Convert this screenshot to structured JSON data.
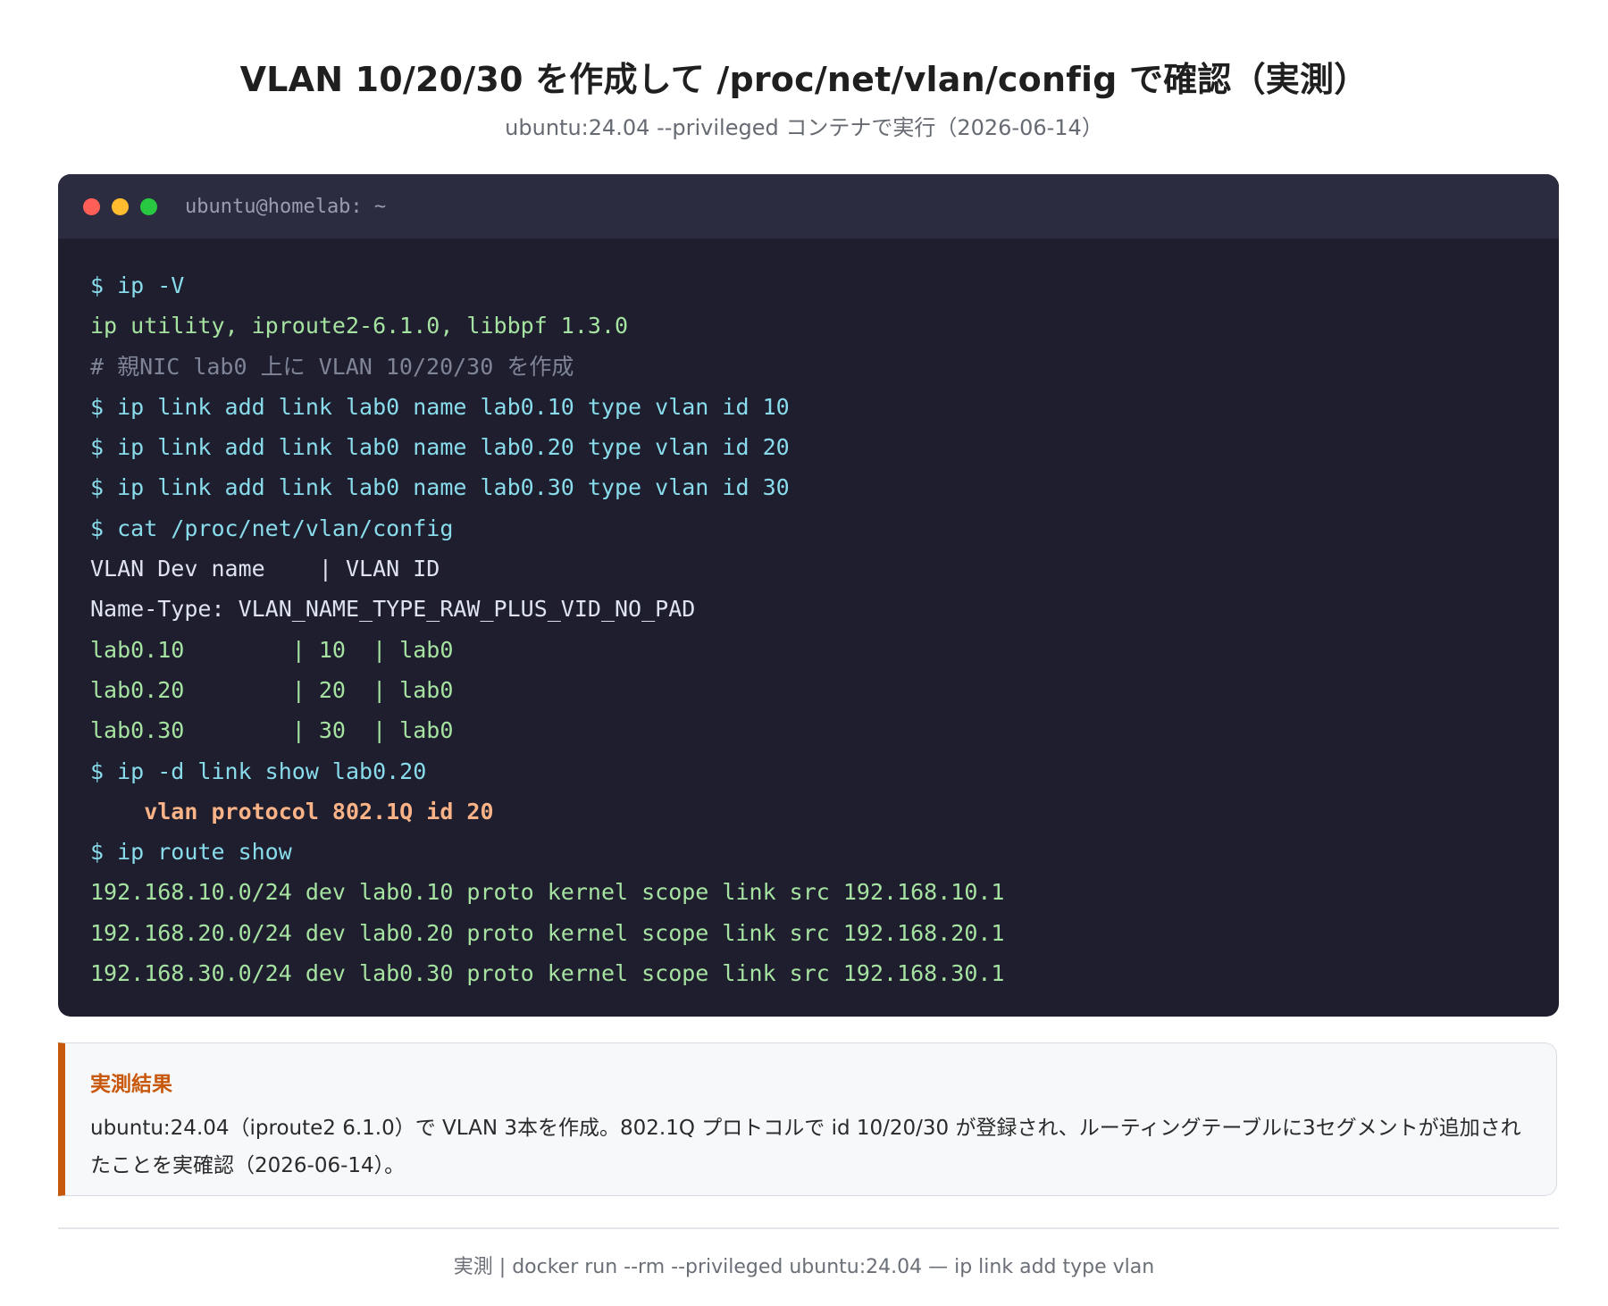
{
  "header": {
    "title": "VLAN 10/20/30 を作成して /proc/net/vlan/config で確認（実測）",
    "subtitle": "ubuntu:24.04 --privileged コンテナで実行（2026-06-14）"
  },
  "terminal": {
    "window_title": "ubuntu@homelab: ~",
    "lines": [
      {
        "text": "$ ip -V",
        "kind": "cmd"
      },
      {
        "text": "ip utility, iproute2-6.1.0, libbpf 1.3.0",
        "kind": "out-green"
      },
      {
        "text": "# 親NIC lab0 上に VLAN 10/20/30 を作成",
        "kind": "comment"
      },
      {
        "text": "$ ip link add link lab0 name lab0.10 type vlan id 10",
        "kind": "cmd"
      },
      {
        "text": "$ ip link add link lab0 name lab0.20 type vlan id 20",
        "kind": "cmd"
      },
      {
        "text": "$ ip link add link lab0 name lab0.30 type vlan id 30",
        "kind": "cmd"
      },
      {
        "text": "$ cat /proc/net/vlan/config",
        "kind": "cmd"
      },
      {
        "text": "VLAN Dev name    | VLAN ID",
        "kind": "out-plain"
      },
      {
        "text": "Name-Type: VLAN_NAME_TYPE_RAW_PLUS_VID_NO_PAD",
        "kind": "out-plain"
      },
      {
        "text": "lab0.10        | 10  | lab0",
        "kind": "out-green"
      },
      {
        "text": "lab0.20        | 20  | lab0",
        "kind": "out-green"
      },
      {
        "text": "lab0.30        | 30  | lab0",
        "kind": "out-green"
      },
      {
        "text": "$ ip -d link show lab0.20",
        "kind": "cmd"
      },
      {
        "text": "    vlan protocol 802.1Q id 20",
        "kind": "highlight"
      },
      {
        "text": "$ ip route show",
        "kind": "cmd"
      },
      {
        "text": "192.168.10.0/24 dev lab0.10 proto kernel scope link src 192.168.10.1",
        "kind": "out-green"
      },
      {
        "text": "192.168.20.0/24 dev lab0.20 proto kernel scope link src 192.168.20.1",
        "kind": "out-green"
      },
      {
        "text": "192.168.30.0/24 dev lab0.30 proto kernel scope link src 192.168.30.1",
        "kind": "out-green"
      }
    ]
  },
  "result": {
    "heading": "実測結果",
    "body": "ubuntu:24.04（iproute2 6.1.0）で VLAN 3本を作成。802.1Q プロトコルで id 10/20/30 が登録され、ルーティングテーブルに3セグメントが追加されたことを実確認（2026-06-14）。"
  },
  "footer": {
    "text": "実測 | docker run --rm --privileged ubuntu:24.04 — ip link add type vlan"
  },
  "colors": {
    "terminal_bg": "#1e1e2e",
    "terminal_bar": "#2b2c40",
    "command": "#89dceb",
    "output_green": "#a6e3a1",
    "comment": "#7f8497",
    "highlight": "#fab387",
    "accent": "#c8580c"
  }
}
